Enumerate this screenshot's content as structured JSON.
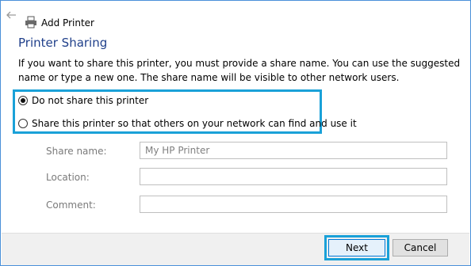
{
  "window": {
    "title": "Add Printer"
  },
  "page": {
    "heading": "Printer Sharing",
    "description": "If you want to share this printer, you must provide a share name. You can use the suggested name or type a new one. The share name will be visible to other network users."
  },
  "sharing": {
    "options": [
      {
        "label": "Do not share this printer",
        "selected": true
      },
      {
        "label": "Share this printer so that others on your network can find and use it",
        "selected": false
      }
    ]
  },
  "fields": {
    "share_name": {
      "label": "Share name:",
      "value": "My HP Printer"
    },
    "location": {
      "label": "Location:",
      "value": ""
    },
    "comment": {
      "label": "Comment:",
      "value": ""
    }
  },
  "buttons": {
    "next": "Next",
    "cancel": "Cancel"
  },
  "colors": {
    "heading": "#1f3f8a",
    "highlight": "#1aa1d8"
  }
}
